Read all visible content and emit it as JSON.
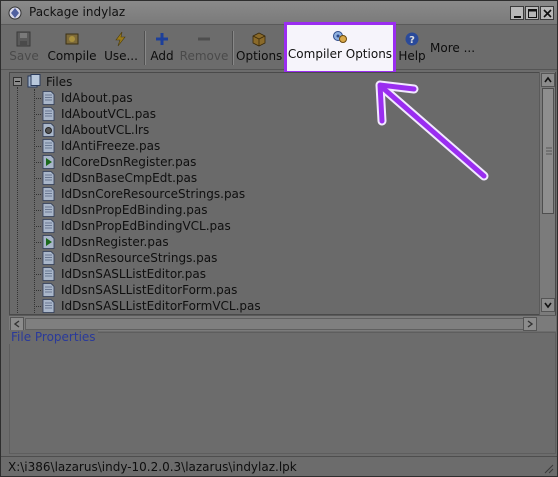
{
  "window": {
    "title": "Package indylaz"
  },
  "toolbar": {
    "items": [
      {
        "label": "Save",
        "icon": "floppy-disk-icon",
        "enabled": false
      },
      {
        "label": "Compile",
        "icon": "compile-icon",
        "enabled": true
      },
      {
        "label": "Use...",
        "icon": "lightning-icon",
        "enabled": true
      },
      {
        "label": "Add",
        "icon": "plus-icon",
        "enabled": true
      },
      {
        "label": "Remove",
        "icon": "minus-icon",
        "enabled": false
      },
      {
        "label": "Options",
        "icon": "options-icon",
        "enabled": true
      },
      {
        "label": "Compiler Options",
        "icon": "compiler-options-icon",
        "enabled": true,
        "highlighted": true
      },
      {
        "label": "Help",
        "icon": "help-icon",
        "enabled": true
      },
      {
        "label": "More ...",
        "icon": "",
        "enabled": true
      }
    ],
    "highlight_color": "#9a2df0"
  },
  "tree": {
    "root_label": "Files",
    "files": [
      {
        "name": "IdAbout.pas",
        "icon": "pascal-file-icon"
      },
      {
        "name": "IdAboutVCL.pas",
        "icon": "pascal-file-icon"
      },
      {
        "name": "IdAboutVCL.lrs",
        "icon": "resource-file-icon"
      },
      {
        "name": "IdAntiFreeze.pas",
        "icon": "pascal-file-icon"
      },
      {
        "name": "IdCoreDsnRegister.pas",
        "icon": "register-unit-icon"
      },
      {
        "name": "IdDsnBaseCmpEdt.pas",
        "icon": "pascal-file-icon"
      },
      {
        "name": "IdDsnCoreResourceStrings.pas",
        "icon": "pascal-file-icon"
      },
      {
        "name": "IdDsnPropEdBinding.pas",
        "icon": "pascal-file-icon"
      },
      {
        "name": "IdDsnPropEdBindingVCL.pas",
        "icon": "pascal-file-icon"
      },
      {
        "name": "IdDsnRegister.pas",
        "icon": "register-unit-icon"
      },
      {
        "name": "IdDsnResourceStrings.pas",
        "icon": "pascal-file-icon"
      },
      {
        "name": "IdDsnSASLListEditor.pas",
        "icon": "pascal-file-icon"
      },
      {
        "name": "IdDsnSASLListEditorForm.pas",
        "icon": "pascal-file-icon"
      },
      {
        "name": "IdDsnSASLListEditorFormVCL.pas",
        "icon": "pascal-file-icon"
      }
    ]
  },
  "properties": {
    "title": "File Properties"
  },
  "status": {
    "path": "X:\\i386\\lazarus\\indy-10.2.0.3\\lazarus\\indylaz.lpk"
  },
  "annotation": {
    "arrow_color": "#9a2df0"
  }
}
